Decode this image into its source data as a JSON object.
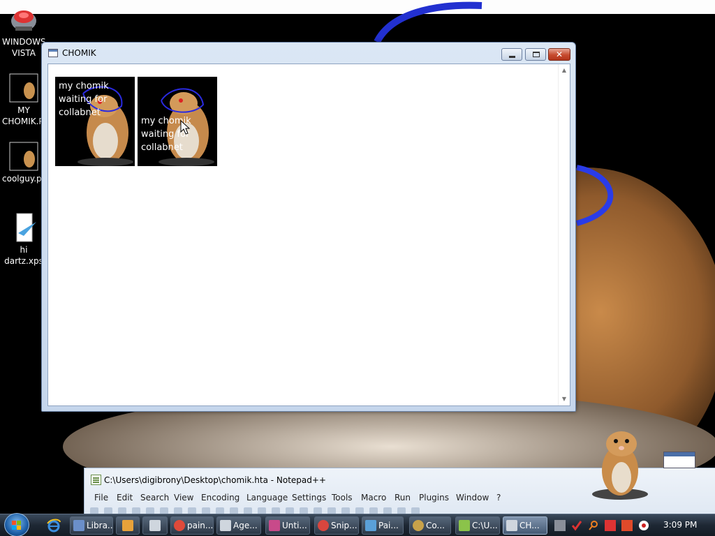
{
  "desktop": {
    "icons": [
      {
        "label": "WINDOWS\nVISTA",
        "name": "vista-icon"
      },
      {
        "label": "MY\nCHOMIK.PNG",
        "name": "chomik-png-icon"
      },
      {
        "label": "coolguy.png",
        "name": "coolguy-png-icon"
      },
      {
        "label": "hi dartz.xps",
        "name": "xps-icon"
      }
    ]
  },
  "window": {
    "title": "CHOMIK",
    "thumbnails": [
      {
        "caption": "my chomik\nwaiting for\ncollabnet"
      },
      {
        "caption": "my chomik\nwaiting for\ncollabnet"
      }
    ]
  },
  "notepad": {
    "title": "C:\\Users\\digibrony\\Desktop\\chomik.hta - Notepad++",
    "menu": [
      "File",
      "Edit",
      "Search",
      "View",
      "Encoding",
      "Language",
      "Settings",
      "Tools",
      "Macro",
      "Run",
      "Plugins",
      "Window",
      "?"
    ]
  },
  "taskbar": {
    "buttons": [
      {
        "label": "Libra...",
        "icon": "library-icon",
        "color": "#6b8fc9"
      },
      {
        "label": "",
        "icon": "media-player-icon",
        "color": "#e8a23a"
      },
      {
        "label": "",
        "icon": "calculator-icon",
        "color": "#cfd6de"
      },
      {
        "label": "pain...",
        "icon": "chrome-icon",
        "color": "#e04a3a"
      },
      {
        "label": "Age...",
        "icon": "window-icon",
        "color": "#cfd6de"
      },
      {
        "label": "Unti...",
        "icon": "paint-app-icon",
        "color": "#c84a8a"
      },
      {
        "label": "Snip...",
        "icon": "snipping-tool-icon",
        "color": "#d9463e"
      },
      {
        "label": "Pai...",
        "icon": "paint-icon",
        "color": "#5aa0d8"
      },
      {
        "label": "Co...",
        "icon": "coin-icon",
        "color": "#c8a24a"
      },
      {
        "label": "C:\\U...",
        "icon": "notepadpp-icon",
        "color": "#8bc34a"
      },
      {
        "label": "CH...",
        "icon": "window-icon",
        "color": "#cfd6de"
      }
    ],
    "clock": "3:09 PM"
  }
}
